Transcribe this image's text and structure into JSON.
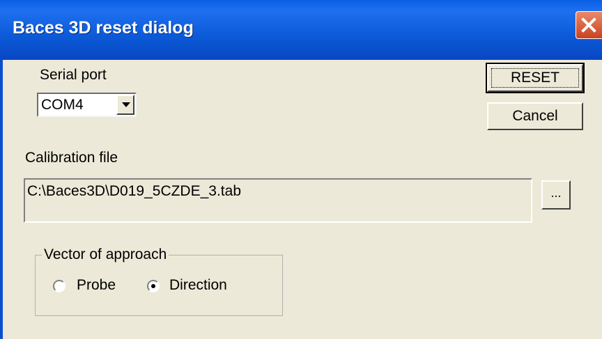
{
  "window": {
    "title": "Baces 3D reset dialog",
    "close_icon": "close-icon"
  },
  "serial_port": {
    "label": "Serial port",
    "selected": "COM4"
  },
  "buttons": {
    "reset_label": "RESET",
    "cancel_label": "Cancel",
    "browse_label": "..."
  },
  "calibration": {
    "label": "Calibration file",
    "value": "C:\\Baces3D\\D019_5CZDE_3.tab"
  },
  "vector": {
    "group_title": "Vector of approach",
    "options": [
      {
        "label": "Probe",
        "selected": false
      },
      {
        "label": "Direction",
        "selected": true
      }
    ]
  },
  "colors": {
    "titlebar": "#0a5fe4",
    "dialog_bg": "#ece9d8",
    "close_button": "#c9421f"
  }
}
